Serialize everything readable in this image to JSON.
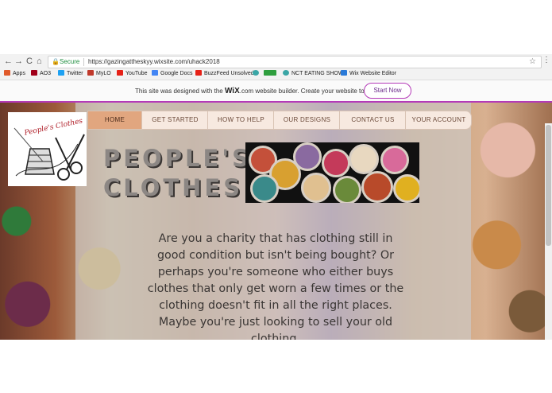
{
  "browser": {
    "nav": {
      "back": "←",
      "forward": "→",
      "reload": "C",
      "home": "⌂"
    },
    "address": {
      "secure_label": "Secure",
      "url": "https://gazingattheskyy.wixsite.com/uhack2018",
      "star": "☆"
    },
    "menu": "⋮",
    "bookmarks": [
      {
        "label": "Apps",
        "color": "#e05a2a"
      },
      {
        "label": "AO3",
        "color": "#a1001a"
      },
      {
        "label": "Twitter",
        "color": "#1da1f2"
      },
      {
        "label": "MyLO",
        "color": "#c0392b"
      },
      {
        "label": "YouTube",
        "color": "#e62117"
      },
      {
        "label": "Google Docs",
        "color": "#4285f4"
      },
      {
        "label": "BuzzFeed Unsolved",
        "color": "#e62117"
      },
      {
        "label": "",
        "color": "#3aa6a6"
      },
      {
        "label": "",
        "color": "#2e9e3e"
      },
      {
        "label": "NCT EATING SHOW",
        "color": "#3aa6a6"
      },
      {
        "label": "Wix Website Editor",
        "color": "#2a7ad8"
      }
    ]
  },
  "wix_banner": {
    "text_before": "This site was designed with the ",
    "brand": "WiX",
    "text_after": ".com website builder. Create your website today.",
    "button": "Start Now"
  },
  "site": {
    "logo_text": "People's Clothes",
    "nav": [
      "HOME",
      "GET STARTED",
      "HOW TO HELP",
      "OUR DESIGNS",
      "CONTACT US",
      "YOUR ACCOUNT"
    ],
    "active_nav": "HOME",
    "title_line1": "PEOPLE'S",
    "title_line2": "CLOTHES",
    "intro": "Are you a charity that has clothing still in good condition but isn't being bought? Or perhaps you're someone who either buys clothes that only get worn a few times or the clothing doesn't fit in all the right places. Maybe you're just looking to sell your old clothing."
  }
}
